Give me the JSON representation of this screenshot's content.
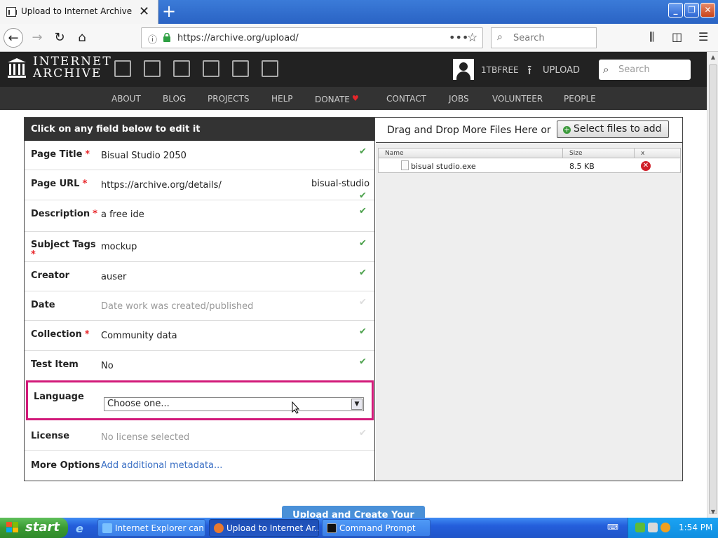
{
  "browser": {
    "tab_title": "Upload to Internet Archive",
    "new_tab_label": "+",
    "url": "https://archive.org/upload/",
    "search_placeholder": "Search"
  },
  "ia_header": {
    "brand_line1": "INTERNET",
    "brand_line2": "ARCHIVE",
    "username": "1TBFREE",
    "upload_label": "UPLOAD",
    "search_placeholder": "Search"
  },
  "ia_nav": [
    "ABOUT",
    "BLOG",
    "PROJECTS",
    "HELP",
    "DONATE",
    "CONTACT",
    "JOBS",
    "VOLUNTEER",
    "PEOPLE"
  ],
  "form": {
    "header": "Click on any field below to edit it",
    "rows": [
      {
        "label": "Page Title",
        "required": true,
        "value": "Bisual Studio 2050",
        "status": "ok"
      },
      {
        "label": "Page URL",
        "required": true,
        "value": "https://archive.org/details/",
        "suffix": "bisual-studio",
        "status": "ok"
      },
      {
        "label": "Description",
        "required": true,
        "value": "a free ide",
        "status": "ok"
      },
      {
        "label": "Subject Tags",
        "required": true,
        "value": "mockup",
        "status": "ok"
      },
      {
        "label": "Creator",
        "required": false,
        "value": "auser",
        "status": "ok"
      },
      {
        "label": "Date",
        "required": false,
        "value": "Date work was created/published",
        "status": "empty"
      },
      {
        "label": "Collection",
        "required": true,
        "value": "Community data",
        "status": "ok"
      },
      {
        "label": "Test Item",
        "required": false,
        "value": "No",
        "status": "ok"
      },
      {
        "label": "License",
        "required": false,
        "value": "No license selected",
        "status": "empty"
      },
      {
        "label": "More Options",
        "required": false,
        "value": "Add additional metadata...",
        "status": "none"
      }
    ],
    "language": {
      "label": "Language",
      "selected": "Choose one..."
    },
    "required_mark": "*",
    "check_mark": "✔"
  },
  "files": {
    "drop_text": "Drag and Drop More Files Here or",
    "select_button": "Select files to add",
    "columns": [
      "Name",
      "Size",
      "x"
    ],
    "rows": [
      {
        "name": "bisual studio.exe",
        "size": "8.5 KB"
      }
    ]
  },
  "submit_label": "Upload and Create Your Item",
  "taskbar": {
    "start_label": "start",
    "tasks": [
      "Internet Explorer can...",
      "Upload to Internet Ar...",
      "Command Prompt"
    ],
    "clock": "1:54 PM"
  },
  "colors": {
    "required": "#e8262a",
    "check": "#4aa04a",
    "highlight": "#d21a7a",
    "ia_dark": "#222222"
  }
}
